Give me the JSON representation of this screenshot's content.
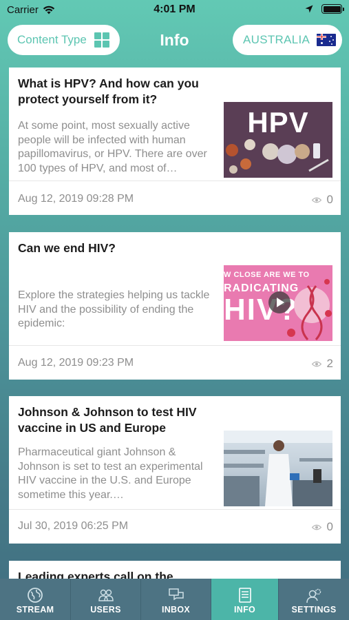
{
  "status_bar": {
    "carrier": "Carrier",
    "time": "4:01 PM"
  },
  "header": {
    "content_type_label": "Content Type",
    "title": "Info",
    "country_label": "AUSTRALIA",
    "accent_color": "#5cc5b1"
  },
  "cards": [
    {
      "title": "What is HPV? And how can you protect yourself from it?",
      "description": "At some point, most sexually active people will be infected with human papillomavirus, or HPV. There are over 100 types of HPV, and most of…",
      "date": "Aug 12, 2019 09:28 PM",
      "views": "0",
      "thumb_text": "HPV"
    },
    {
      "title": "Can we end HIV?",
      "description": "Explore the strategies helping us tackle HIV and the possibility of ending the epidemic:",
      "date": "Aug 12, 2019 09:23 PM",
      "views": "2",
      "thumb_line1": "W CLOSE ARE WE TO",
      "thumb_line2": "RADICATING",
      "thumb_line3": "HIV?"
    },
    {
      "title": "Johnson & Johnson to test HIV vaccine in US and Europe",
      "description": "Pharmaceutical giant Johnson & Johnson is set to test an experimental HIV vaccine in the U.S. and Europe sometime this year.…",
      "date": "Jul 30, 2019 06:25 PM",
      "views": "0"
    },
    {
      "title": "Leading experts call on the"
    }
  ],
  "tabs": [
    {
      "label": "STREAM",
      "icon": "globe-icon"
    },
    {
      "label": "USERS",
      "icon": "users-icon"
    },
    {
      "label": "INBOX",
      "icon": "inbox-icon"
    },
    {
      "label": "INFO",
      "icon": "document-icon",
      "active": true
    },
    {
      "label": "SETTINGS",
      "icon": "settings-user-icon"
    }
  ]
}
